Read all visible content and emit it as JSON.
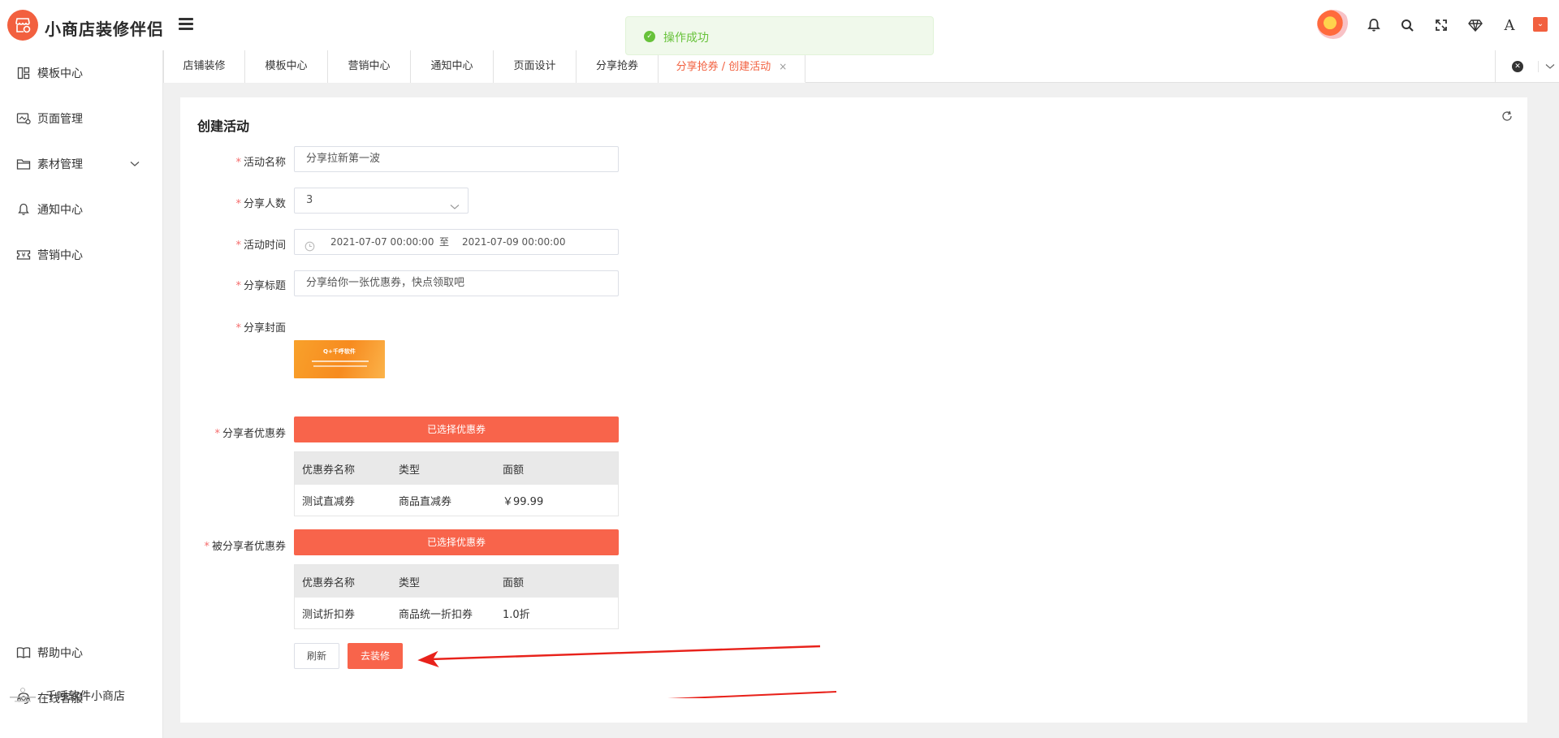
{
  "app": {
    "title": "小商店装修伴侣"
  },
  "toast": {
    "message": "操作成功"
  },
  "header": {
    "icons": [
      "user-avatar-icon",
      "bell-icon",
      "search-icon",
      "fullscreen-icon",
      "diamond-icon",
      "font-icon",
      "user-menu-icon"
    ]
  },
  "sidebar": {
    "items": [
      {
        "label": "模板中心",
        "icon": "layout-icon"
      },
      {
        "label": "页面管理",
        "icon": "page-icon"
      },
      {
        "label": "素材管理",
        "icon": "folder-icon",
        "expandable": true
      },
      {
        "label": "通知中心",
        "icon": "bell-icon"
      },
      {
        "label": "营销中心",
        "icon": "ticket-icon"
      }
    ],
    "bottom_items": [
      {
        "label": "帮助中心",
        "icon": "book-icon"
      },
      {
        "label": "在线客服",
        "icon": "headset-icon"
      }
    ],
    "footer": {
      "shop_name": "千呼软件小商店"
    }
  },
  "tabs": [
    {
      "label": "店铺装修"
    },
    {
      "label": "模板中心"
    },
    {
      "label": "营销中心"
    },
    {
      "label": "通知中心"
    },
    {
      "label": "页面设计"
    },
    {
      "label": "分享抢券"
    },
    {
      "label": "分享抢券 / 创建活动",
      "active": true,
      "close": "×"
    }
  ],
  "form": {
    "title": "创建活动",
    "required_mark": "*",
    "fields": {
      "name": {
        "label": "活动名称",
        "value": "分享拉新第一波"
      },
      "share_count": {
        "label": "分享人数",
        "value": "3"
      },
      "time": {
        "label": "活动时间",
        "start": "2021-07-07 00:00:00",
        "separator": "至",
        "end": "2021-07-09 00:00:00"
      },
      "share_title": {
        "label": "分享标题",
        "value": "分享给你一张优惠券，快点领取吧"
      },
      "cover": {
        "label": "分享封面",
        "brand": "Q+千呼软件"
      }
    },
    "sharer_coupon": {
      "label": "分享者优惠券",
      "button": "已选择优惠券",
      "columns": [
        "优惠券名称",
        "类型",
        "面额"
      ],
      "rows": [
        [
          "测试直减券",
          "商品直减券",
          "￥99.99"
        ]
      ]
    },
    "sharee_coupon": {
      "label": "被分享者优惠券",
      "button": "已选择优惠券",
      "columns": [
        "优惠券名称",
        "类型",
        "面额"
      ],
      "rows": [
        [
          "测试折扣券",
          "商品统一折扣券",
          "1.0折"
        ]
      ]
    },
    "buttons": {
      "reset": "刷新",
      "submit": "去装修"
    }
  },
  "colors": {
    "accent": "#f8644b",
    "success": "#67c23a",
    "annotation": "#e8221b"
  }
}
